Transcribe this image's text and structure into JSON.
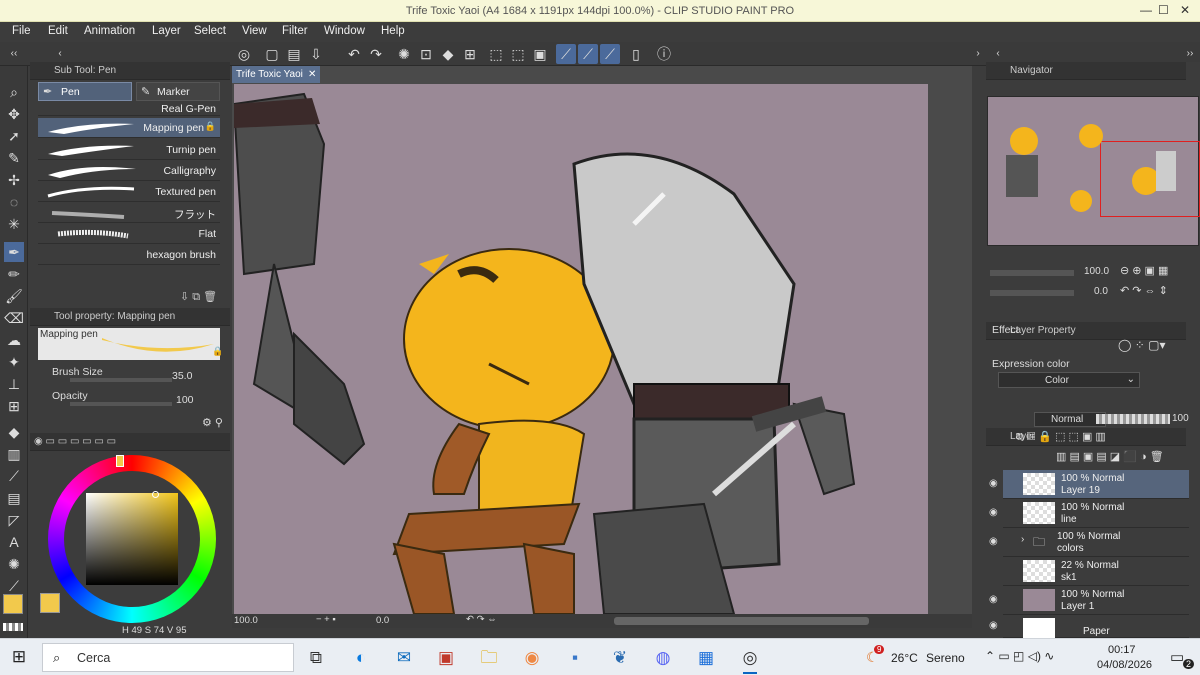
{
  "window": {
    "title": "Trife Toxic Yaoi (A4 1684 x 1191px 144dpi 100.0%) - CLIP STUDIO PAINT PRO",
    "min": "—",
    "max": "☐",
    "close": "✕"
  },
  "menu": [
    "File",
    "Edit",
    "Animation",
    "Layer",
    "Select",
    "View",
    "Filter",
    "Window",
    "Help"
  ],
  "subtool": {
    "header": "Sub Tool: Pen",
    "groups": [
      "Pen",
      "Marker"
    ],
    "brushes": [
      "Real G-Pen",
      "Mapping pen",
      "Turnip pen",
      "Calligraphy",
      "Textured pen",
      "フラット",
      "Flat",
      "hexagon brush"
    ]
  },
  "toolprop": {
    "header": "Tool property: Mapping pen",
    "preview_label": "Mapping pen",
    "brush_size_label": "Brush Size",
    "brush_size_value": "35.0",
    "opacity_label": "Opacity",
    "opacity_value": "100"
  },
  "color": {
    "h": "49",
    "s": "74",
    "v": "95",
    "main": "#f2c94c",
    "sub": "#f2c94c"
  },
  "canvas": {
    "tab": "Trife Toxic Yaoi",
    "zoom": "100.0",
    "angle": "0.0",
    "bg": "#9a8996"
  },
  "navigator": {
    "header": "Navigator",
    "zoom_value": "100.0",
    "angle_value": "0.0"
  },
  "layer_property": {
    "header": "Layer Property",
    "effect_label": "Effect",
    "expression_label": "Expression color",
    "expression_value": "Color"
  },
  "layer_panel": {
    "header": "Layer",
    "blend_mode": "Normal",
    "opacity": "100",
    "layers": [
      {
        "mode": "100 % Normal",
        "name": "Layer 19"
      },
      {
        "mode": "100 % Normal",
        "name": "line"
      },
      {
        "mode": "100 % Normal",
        "name": "colors"
      },
      {
        "mode": "22 % Normal",
        "name": "sk1"
      },
      {
        "mode": "100 % Normal",
        "name": "Layer 1"
      },
      {
        "mode": "",
        "name": "Paper"
      }
    ]
  },
  "taskbar": {
    "search": "Cerca",
    "weather_temp": "26°C",
    "weather_desc": "Sereno",
    "weather_badge": "9",
    "time": "00:17",
    "date": "04/08/2026",
    "notif_count": "2"
  }
}
